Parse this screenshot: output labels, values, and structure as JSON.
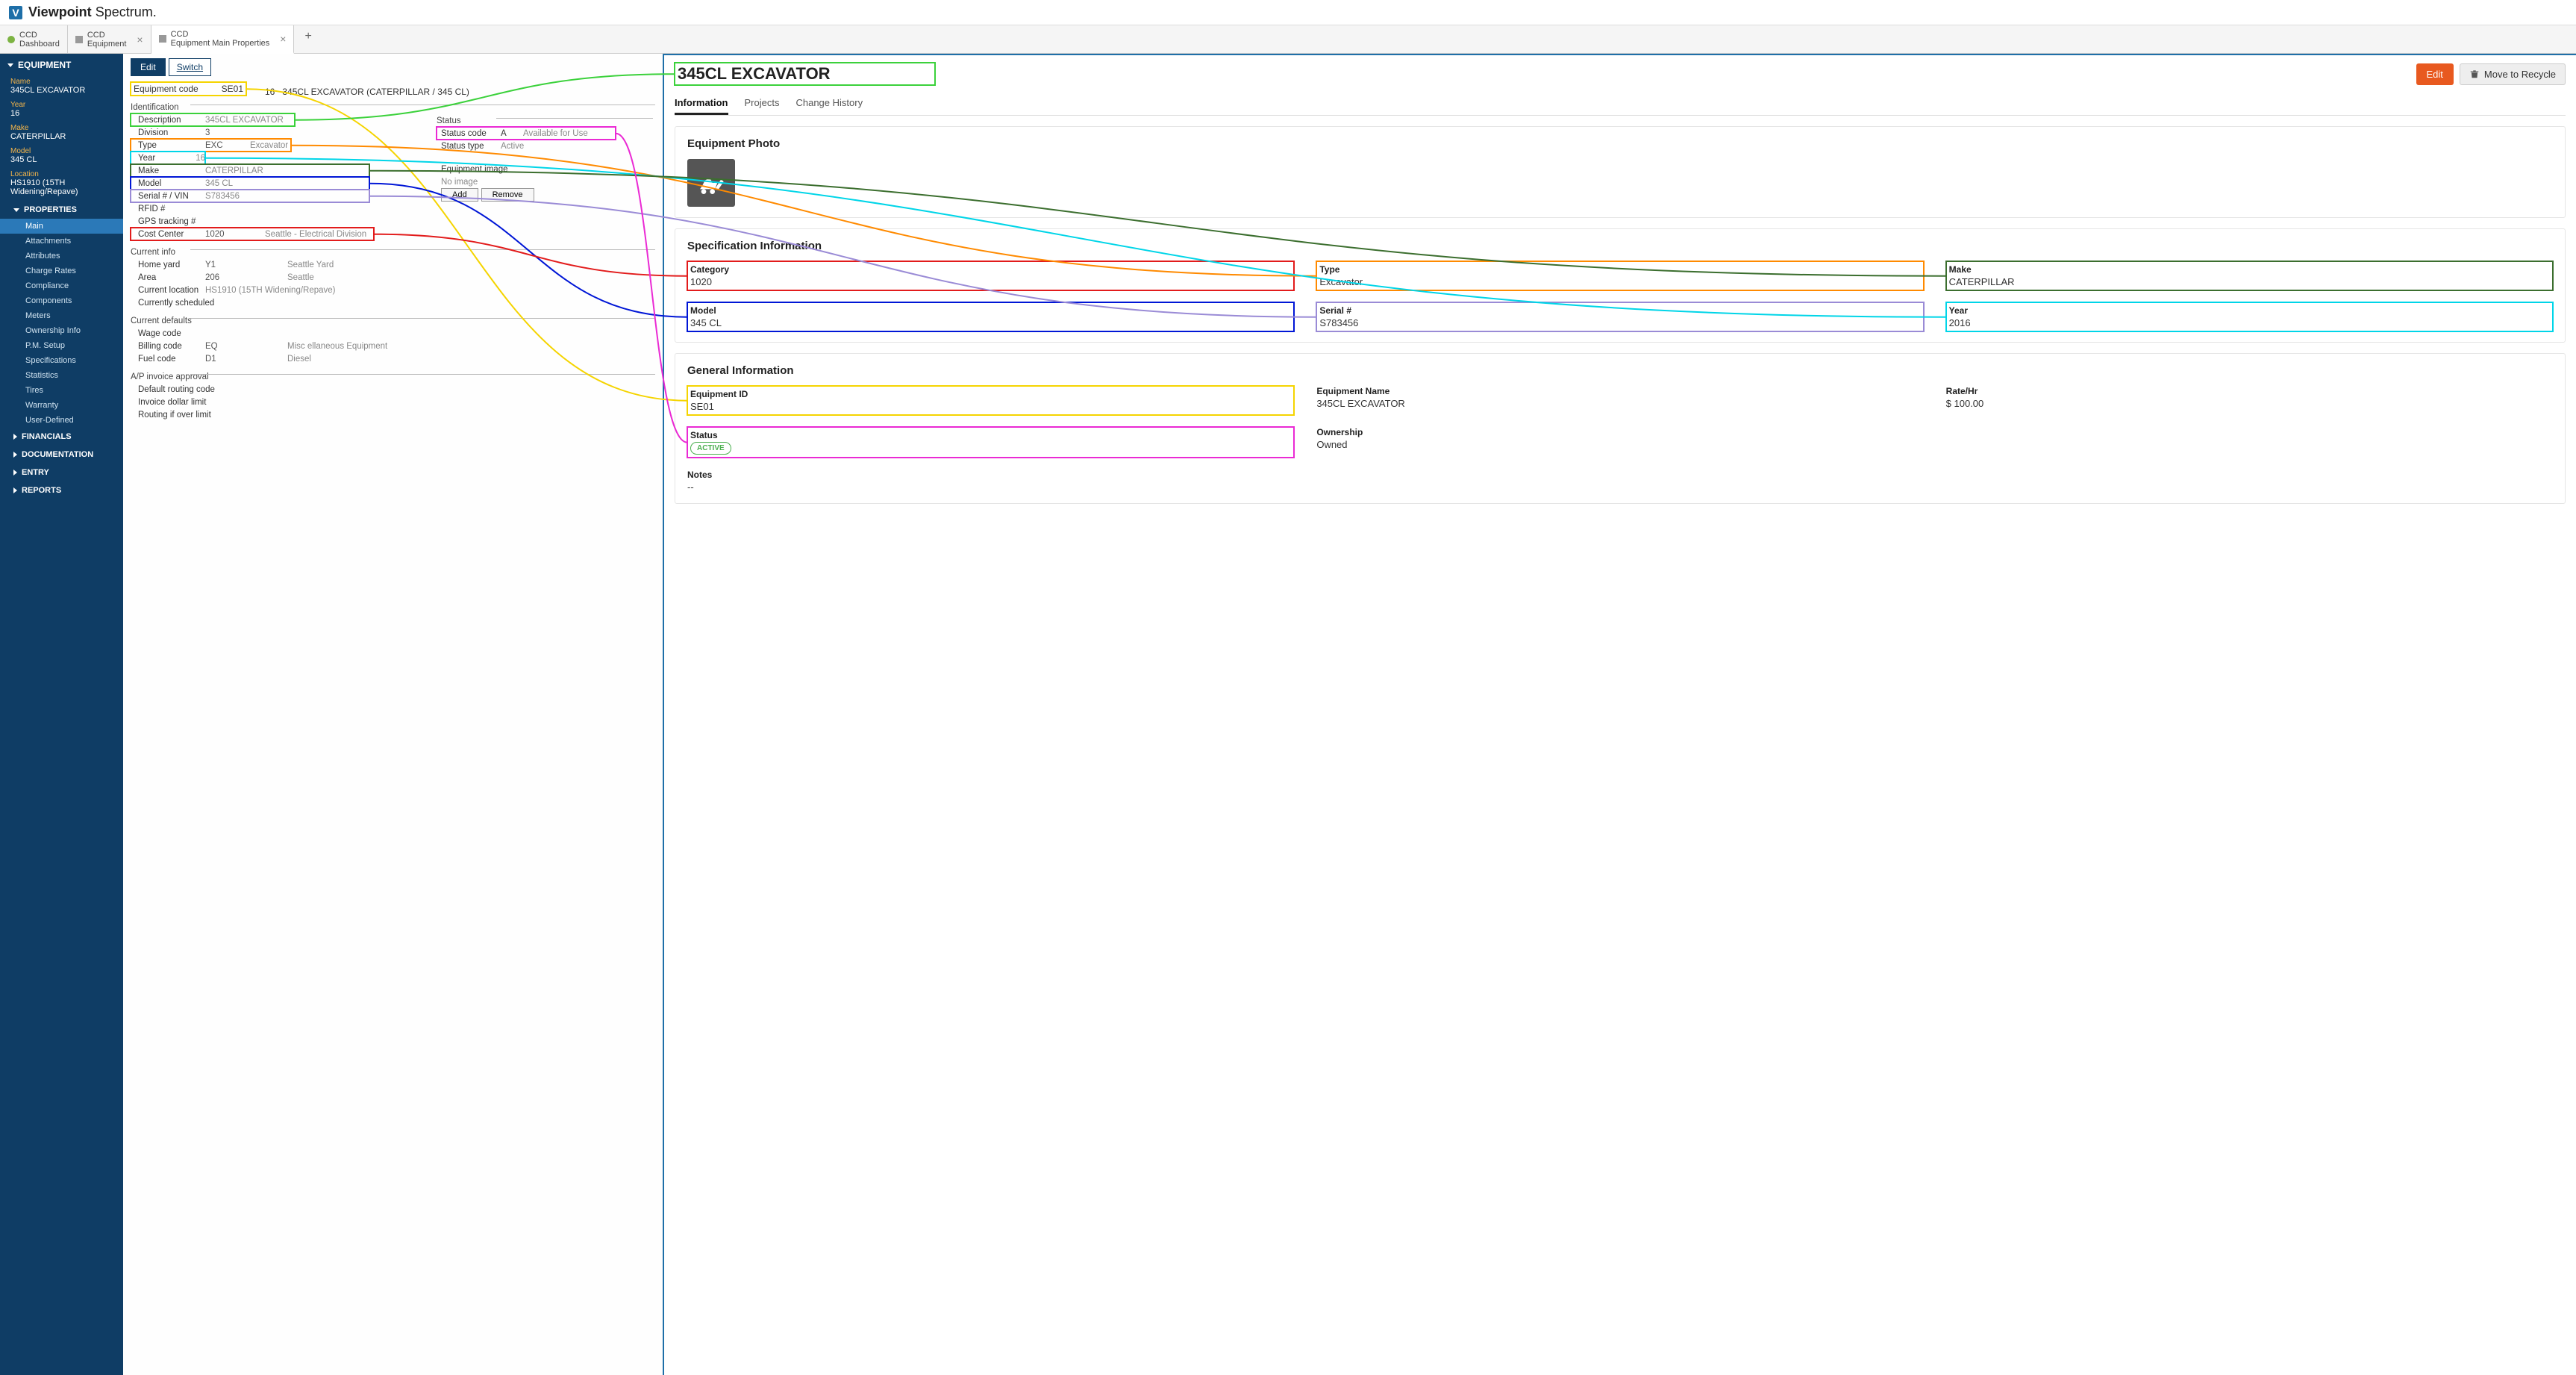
{
  "brand": {
    "mark": "V",
    "name_bold": "Viewpoint",
    "name_light": "Spectrum"
  },
  "tabs": [
    {
      "top": "CCD",
      "bottom": "Dashboard"
    },
    {
      "top": "CCD",
      "bottom": "Equipment"
    },
    {
      "top": "CCD",
      "bottom": "Equipment Main Properties"
    }
  ],
  "sidebar": {
    "header": "EQUIPMENT",
    "fields": {
      "name_label": "Name",
      "name_value": "345CL EXCAVATOR",
      "year_label": "Year",
      "year_value": "16",
      "make_label": "Make",
      "make_value": "CATERPILLAR",
      "model_label": "Model",
      "model_value": "345 CL",
      "location_label": "Location",
      "location_value": "HS1910 (15TH Widening/Repave)"
    },
    "properties_header": "PROPERTIES",
    "properties": [
      "Main",
      "Attachments",
      "Attributes",
      "Charge Rates",
      "Compliance",
      "Components",
      "Meters",
      "Ownership Info",
      "P.M. Setup",
      "Specifications",
      "Statistics",
      "Tires",
      "Warranty",
      "User-Defined"
    ],
    "other_sections": [
      "FINANCIALS",
      "DOCUMENTATION",
      "ENTRY",
      "REPORTS"
    ]
  },
  "form": {
    "edit_btn": "Edit",
    "switch_btn": "Switch",
    "eq_code_label": "Equipment code",
    "eq_code": "SE01",
    "eq_year": "16",
    "eq_desc": "345CL EXCAVATOR (CATERPILLAR / 345 CL)",
    "identification_title": "Identification",
    "description_label": "Description",
    "description": "345CL EXCAVATOR",
    "division_label": "Division",
    "division": "3",
    "type_label": "Type",
    "type": "EXC",
    "type_desc": "Excavator",
    "year_label": "Year",
    "year": "16",
    "make_label": "Make",
    "make": "CATERPILLAR",
    "model_label": "Model",
    "model": "345 CL",
    "serial_label": "Serial # / VIN",
    "serial": "S783456",
    "rfid_label": "RFID #",
    "gps_label": "GPS tracking #",
    "cost_center_label": "Cost Center",
    "cost_center": "1020",
    "cost_center_desc": "Seattle - Electrical Division",
    "status_title": "Status",
    "status_code_label": "Status code",
    "status_code": "A",
    "status_code_desc": "Available for Use",
    "status_type_label": "Status type",
    "status_type": "Active",
    "eq_image_label": "Equipment image",
    "eq_image_value": "No image",
    "add_btn": "Add",
    "remove_btn": "Remove",
    "current_info_title": "Current info",
    "home_yard_label": "Home yard",
    "home_yard": "Y1",
    "home_yard_desc": "Seattle Yard",
    "area_label": "Area",
    "area": "206",
    "area_desc": "Seattle",
    "cur_loc_label": "Current location",
    "cur_loc": "HS1910 (15TH Widening/Repave)",
    "cur_sched_label": "Currently scheduled",
    "defaults_title": "Current defaults",
    "wage_label": "Wage code",
    "billing_label": "Billing code",
    "billing": "EQ",
    "billing_desc": "Misc ellaneous Equipment",
    "fuel_label": "Fuel code",
    "fuel": "D1",
    "fuel_desc": "Diesel",
    "ap_title": "A/P invoice approval",
    "routing_label": "Default routing code",
    "dollar_label": "Invoice dollar limit",
    "over_label": "Routing if over limit"
  },
  "right": {
    "title": "345CL EXCAVATOR",
    "edit_btn": "Edit",
    "recycle_btn": "Move to Recycle",
    "tabs": [
      "Information",
      "Projects",
      "Change History"
    ],
    "photo_title": "Equipment Photo",
    "spec_title": "Specification Information",
    "spec": {
      "category_label": "Category",
      "category": "1020",
      "type_label": "Type",
      "type": "Excavator",
      "make_label": "Make",
      "make": "CATERPILLAR",
      "model_label": "Model",
      "model": "345 CL",
      "serial_label": "Serial #",
      "serial": "S783456",
      "year_label": "Year",
      "year": "2016"
    },
    "gen_title": "General Information",
    "gen": {
      "eqid_label": "Equipment ID",
      "eqid": "SE01",
      "eqname_label": "Equipment Name",
      "eqname": "345CL EXCAVATOR",
      "rate_label": "Rate/Hr",
      "rate": "$ 100.00",
      "status_label": "Status",
      "status": "ACTIVE",
      "own_label": "Ownership",
      "own": "Owned",
      "notes_label": "Notes",
      "notes": "--"
    }
  }
}
